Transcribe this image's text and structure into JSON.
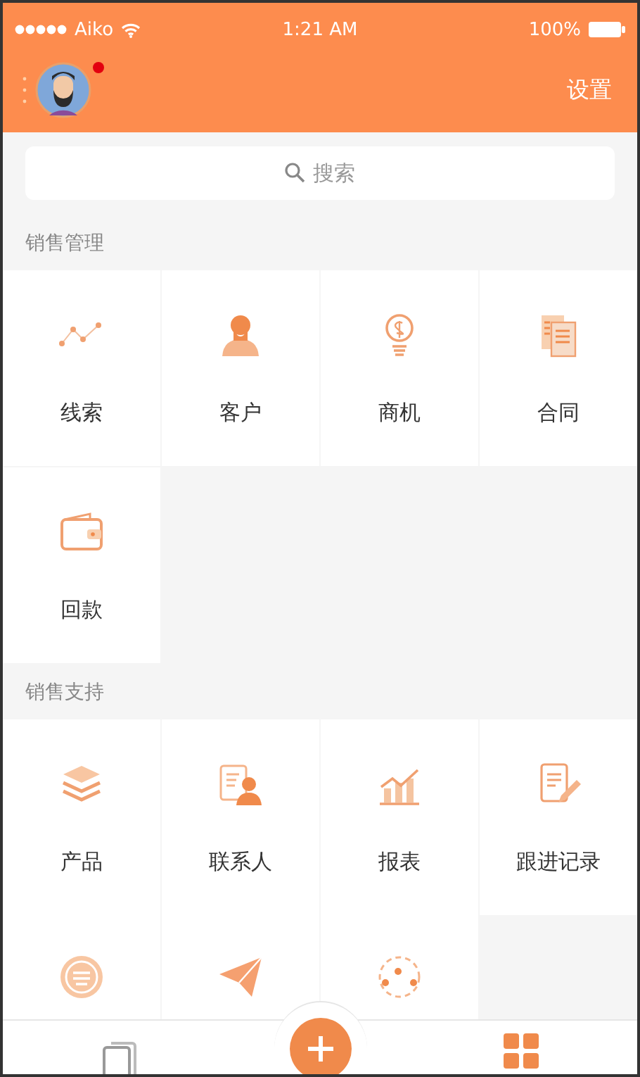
{
  "status_bar": {
    "carrier": "Aiko",
    "time": "1:21 AM",
    "battery": "100%"
  },
  "header": {
    "has_notification": true,
    "settings": "设置"
  },
  "search": {
    "placeholder": "搜索"
  },
  "sections": [
    {
      "title": "销售管理",
      "items": [
        {
          "label": "线索"
        },
        {
          "label": "客户"
        },
        {
          "label": "商机"
        },
        {
          "label": "合同"
        },
        {
          "label": "回款"
        }
      ]
    },
    {
      "title": "销售支持",
      "items": [
        {
          "label": "产品"
        },
        {
          "label": "联系人"
        },
        {
          "label": "报表"
        },
        {
          "label": "跟进记录"
        }
      ]
    }
  ]
}
